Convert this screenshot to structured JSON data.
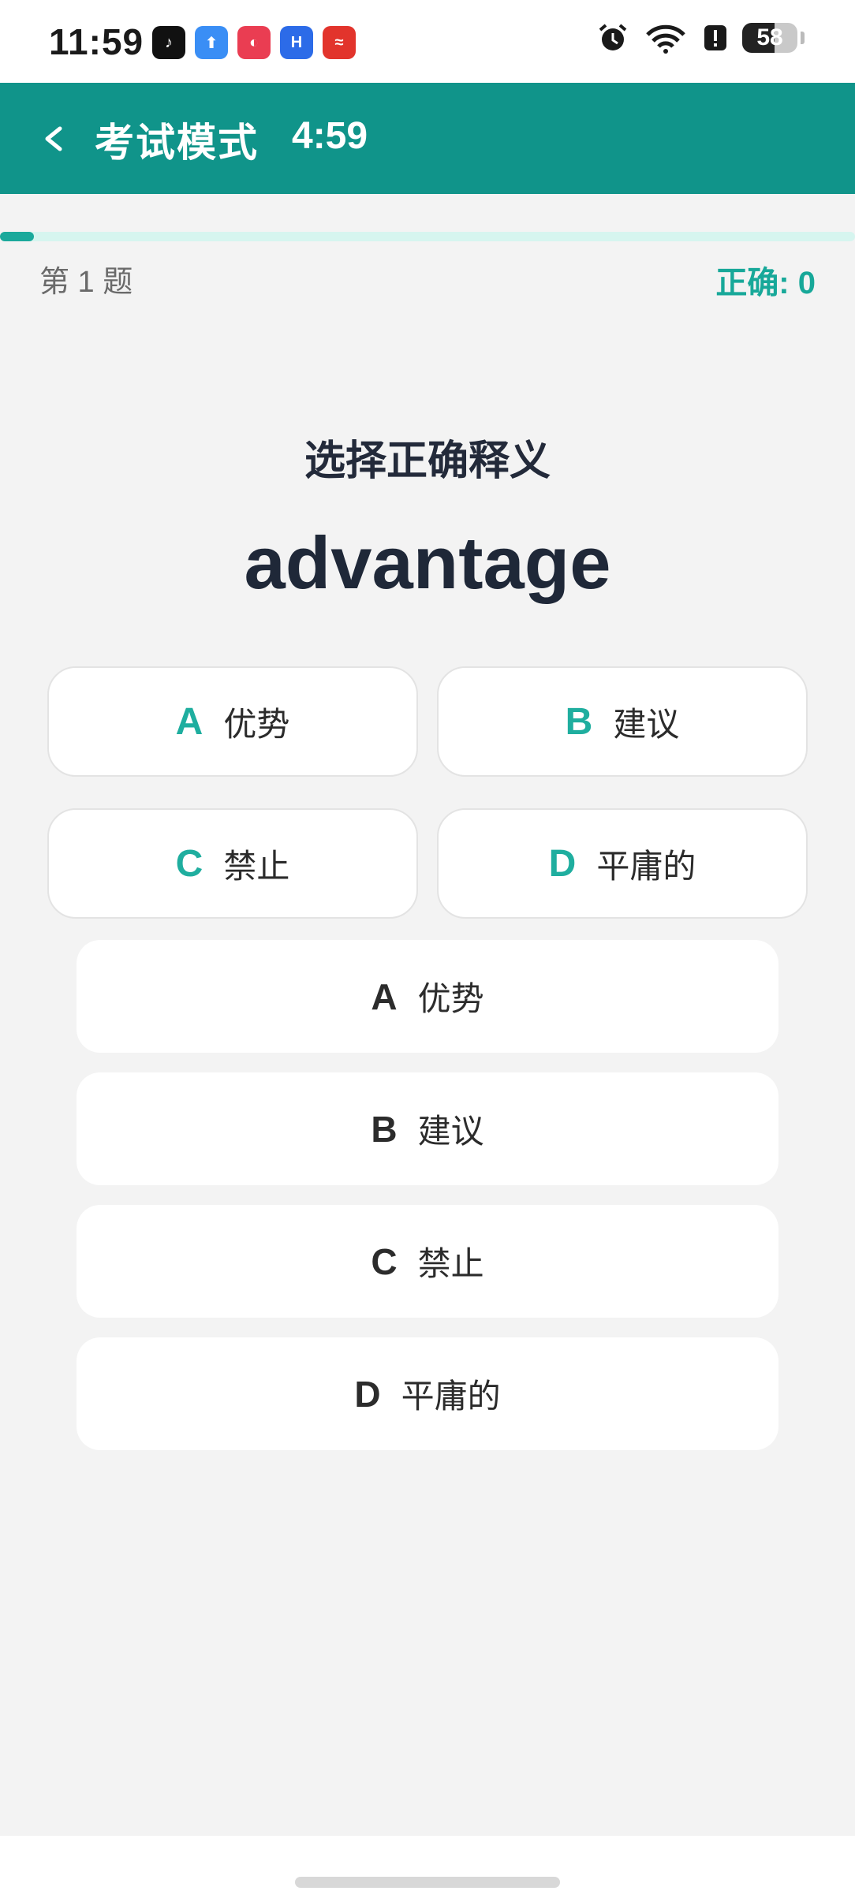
{
  "status_bar": {
    "time": "11:59",
    "battery": "58",
    "app_icons": [
      {
        "name": "tiktok-icon",
        "glyph": "♪",
        "color": "#111111"
      },
      {
        "name": "upload-app-icon",
        "glyph": "⬆",
        "color": "#3a8ef5"
      },
      {
        "name": "app-gallery-icon",
        "glyph": "◐",
        "color": "#ea3d52"
      },
      {
        "name": "h-app-icon",
        "glyph": "H",
        "color": "#2c6be8"
      },
      {
        "name": "red-app-icon",
        "glyph": "≈",
        "color": "#e2342c"
      }
    ]
  },
  "header": {
    "title": "考试模式",
    "timer": "4:59",
    "back_glyph": "<"
  },
  "progress": {
    "fraction": 0.04
  },
  "quiz": {
    "question_index": "第 1 题",
    "score": "正确: 0",
    "prompt": "选择正确释义",
    "word": "advantage"
  },
  "grid_options": [
    {
      "letter": "A",
      "text": "优势"
    },
    {
      "letter": "B",
      "text": "建议"
    },
    {
      "letter": "C",
      "text": "禁止"
    },
    {
      "letter": "D",
      "text": "平庸的"
    }
  ],
  "list_options": [
    {
      "letter": "A",
      "text": "优势"
    },
    {
      "letter": "B",
      "text": "建议"
    },
    {
      "letter": "C",
      "text": "禁止"
    },
    {
      "letter": "D",
      "text": "平庸的"
    }
  ],
  "colors": {
    "accent": "#10948a",
    "accent_text": "#17a899",
    "progress_track": "#d6f5ef"
  }
}
